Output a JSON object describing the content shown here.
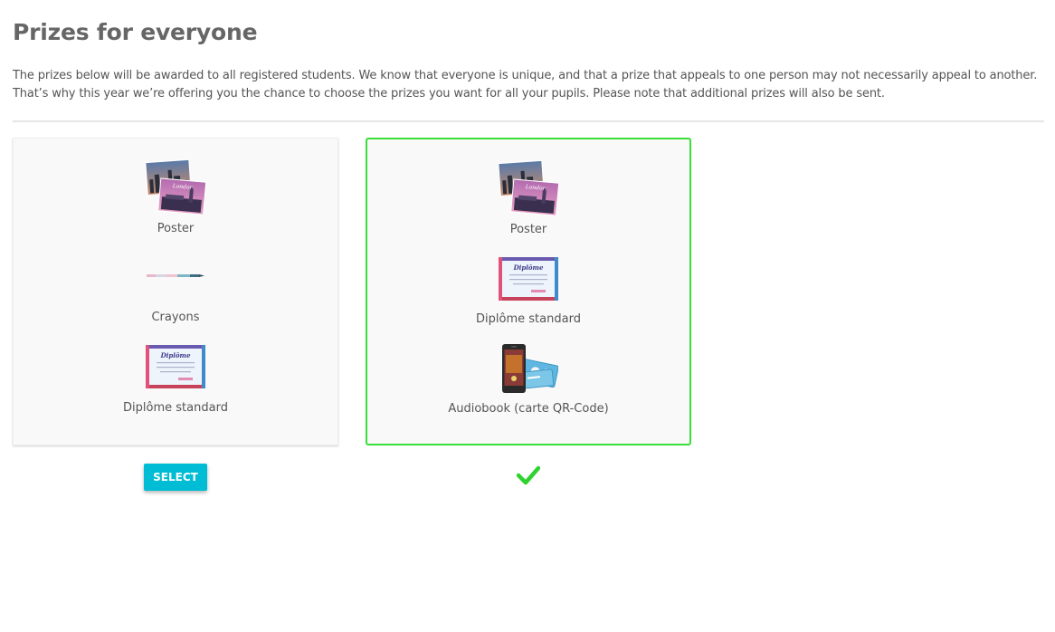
{
  "page": {
    "title": "Prizes for everyone",
    "intro_line1": "The prizes below will be awarded to all registered students. We know that everyone is unique, and that a prize that appeals to one person may not necessarily appeal to another.",
    "intro_line2": "That’s why this year we’re offering you the chance to choose the prizes you want for all your pupils. Please note that additional prizes will also be sent."
  },
  "packs": [
    {
      "selected": false,
      "prizes": [
        {
          "label": "Poster",
          "icon": "poster-icon"
        },
        {
          "label": "Crayons",
          "icon": "crayons-icon"
        },
        {
          "label": "Diplôme standard",
          "icon": "diploma-icon"
        }
      ],
      "select_label": "SELECT"
    },
    {
      "selected": true,
      "prizes": [
        {
          "label": "Poster",
          "icon": "poster-icon"
        },
        {
          "label": "Diplôme standard",
          "icon": "diploma-icon"
        },
        {
          "label": "Audiobook (carte QR-Code)",
          "icon": "audiobook-qr-card-icon"
        }
      ],
      "selected_icon": "checkmark-icon"
    }
  ],
  "colors": {
    "accent": "#00bcd4",
    "selected_border": "#3adf3a",
    "text": "#555555",
    "title": "#666666"
  }
}
